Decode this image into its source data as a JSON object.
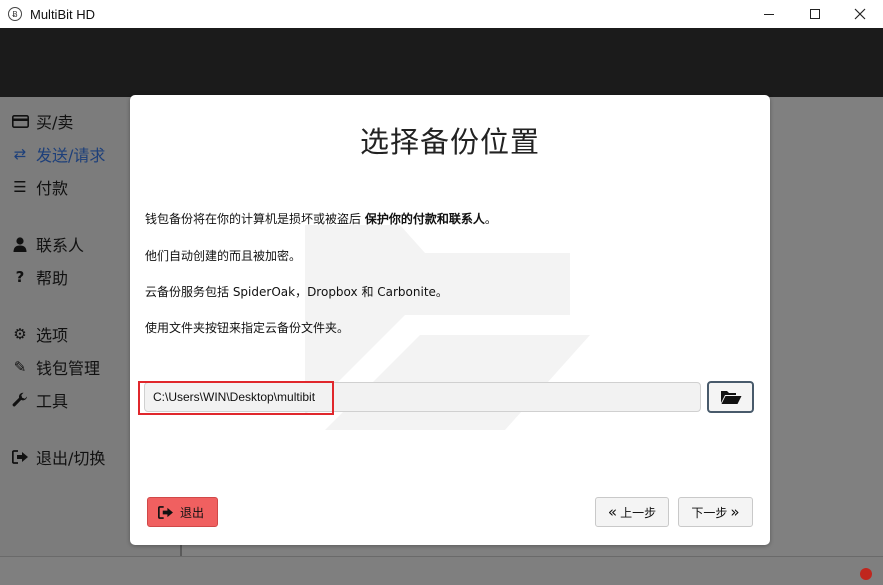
{
  "window": {
    "title": "MultiBit HD",
    "app_icon_glyph": "Ƀ"
  },
  "sidebar": {
    "items": [
      {
        "label": "买/卖",
        "icon": "credit-card-icon",
        "glyph": "▭"
      },
      {
        "label": "发送/请求",
        "icon": "exchange-icon",
        "glyph": "⇄",
        "active": true
      },
      {
        "label": "付款",
        "icon": "list-icon",
        "glyph": "☰"
      },
      {
        "label": "联系人",
        "icon": "user-icon",
        "glyph": "●"
      },
      {
        "label": "帮助",
        "icon": "question-icon",
        "glyph": "?"
      },
      {
        "label": "选项",
        "icon": "gears-icon",
        "glyph": "⚙"
      },
      {
        "label": "钱包管理",
        "icon": "edit-icon",
        "glyph": "✎"
      },
      {
        "label": "工具",
        "icon": "wrench-icon",
        "glyph": "🔧"
      },
      {
        "label": "退出/切换",
        "icon": "sign-out-icon",
        "glyph": "⇥"
      }
    ],
    "active_color": "#1d3f7a"
  },
  "dialog": {
    "title": "选择备份位置",
    "paragraph1_prefix": "钱包备份将在你的计算机是损坏或被盗后",
    "paragraph1_bold": "保护你的付款和联系人",
    "paragraph1_suffix": "。",
    "paragraph2": "他们自动创建的而且被加密。",
    "paragraph3": "云备份服务包括 SpiderOak，Dropbox 和 Carbonite。",
    "paragraph4": "使用文件夹按钮来指定云备份文件夹。",
    "path_value": "C:\\Users\\WIN\\Desktop\\multibit",
    "folder_button_icon": "folder-open-icon",
    "exit_label": "退出",
    "prev_label": "上一步",
    "next_label": "下一步"
  },
  "colors": {
    "exit_button": "#f06060",
    "highlight": "#e0272c",
    "status_dot": "#c0261e",
    "header": "#1b1b1b"
  }
}
